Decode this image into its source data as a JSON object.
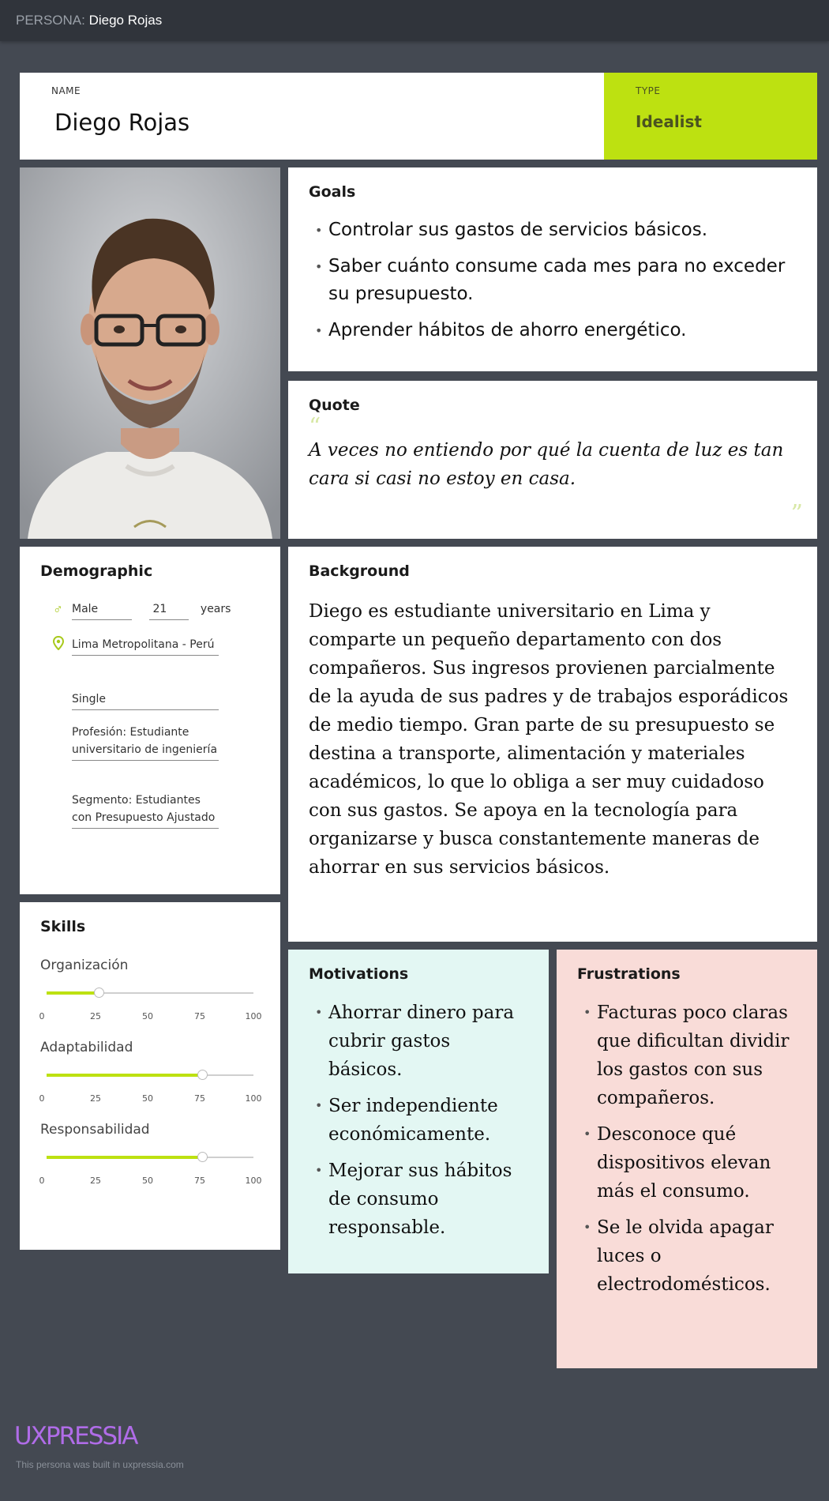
{
  "header": {
    "prefix": "PERSONA:",
    "title": "Diego Rojas"
  },
  "name_card": {
    "label": "NAME",
    "value": "Diego Rojas"
  },
  "type_card": {
    "label": "TYPE",
    "value": "Idealist"
  },
  "goals": {
    "title": "Goals",
    "items": [
      "Controlar sus gastos de servicios básicos.",
      "Saber cuánto consume cada mes para no exceder su presupuesto.",
      "Aprender hábitos de ahorro energético."
    ]
  },
  "quote": {
    "title": "Quote",
    "open_mark": "“",
    "close_mark": "”",
    "text": "A veces no entiendo por qué la cuenta de luz es tan cara si casi no estoy en casa."
  },
  "demographic": {
    "title": "Demographic",
    "gender": "Male",
    "age": "21",
    "age_unit": "years",
    "location": "Lima Metropolitana - Perú",
    "status": "Single",
    "profession": "Profesión: Estudiante universitario de ingeniería",
    "segment": "Segmento: Estudiantes con Presupuesto Ajustado"
  },
  "background": {
    "title": "Background",
    "text": "Diego es estudiante universitario en Lima y comparte un pequeño departamento con dos compañeros. Sus ingresos provienen parcialmente de la ayuda de sus padres y de trabajos esporádicos de medio tiempo. Gran parte de su presupuesto se destina a transporte, alimentación y materiales académicos, lo que lo obliga a ser muy cuidadoso con sus gastos. Se apoya en la tecnología para organizarse y busca constantemente maneras de ahorrar en sus servicios básicos."
  },
  "skills": {
    "title": "Skills",
    "ticks": [
      "0",
      "25",
      "50",
      "75",
      "100"
    ],
    "items": [
      {
        "name": "Organización",
        "value": 25
      },
      {
        "name": "Adaptabilidad",
        "value": 75
      },
      {
        "name": "Responsabilidad",
        "value": 75
      }
    ]
  },
  "motivations": {
    "title": "Motivations",
    "items": [
      "Ahorrar dinero para cubrir gastos básicos.",
      "Ser independiente económicamente.",
      "Mejorar sus hábitos de consumo responsable."
    ]
  },
  "frustrations": {
    "title": "Frustrations",
    "items": [
      "Facturas poco claras que dificultan dividir los gastos con sus compañeros.",
      "Desconoce qué dispositivos elevan más el consumo.",
      "Se le olvida apagar luces o electrodomésticos."
    ]
  },
  "footer": {
    "logo": "UXPRESSIA",
    "note": "This persona was built in uxpressia.com"
  },
  "colors": {
    "accent": "#bde111",
    "background": "#444952",
    "topbar": "#30343b",
    "motivations_bg": "#e3f7f3",
    "frustrations_bg": "#f9dcd8",
    "logo": "#b06ce8"
  },
  "icons": {
    "gender": "male-symbol-icon",
    "location": "location-pin-icon"
  }
}
